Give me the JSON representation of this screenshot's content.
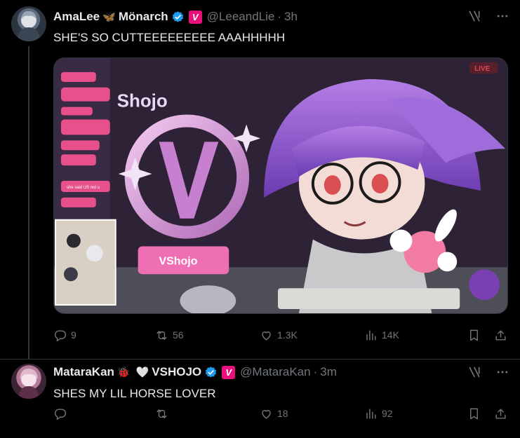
{
  "posts": [
    {
      "display_name": "AmaLee",
      "name_emoji": "🦋",
      "name_suffix": "Mönarch",
      "badge_letter": "V",
      "handle": "@LeeandLie",
      "separator": "·",
      "time": "3h",
      "text": "SHE'S SO CUTTEEEEEEEEE AAAHHHHH",
      "media": {
        "live_label": "LIVE",
        "brand_text": "Shojo",
        "trophy_text": "VShojo",
        "chat_message": "she said US not u"
      },
      "stats": {
        "replies": "9",
        "reposts": "56",
        "likes": "1.3K",
        "views": "14K"
      }
    },
    {
      "display_name": "MataraKan",
      "name_emoji": "🐞",
      "name_heart": "🤍",
      "name_suffix": "VSHOJO",
      "badge_letter": "V",
      "handle": "@MataraKan",
      "separator": "·",
      "time": "3m",
      "text": "SHES MY LIL HORSE LOVER",
      "stats": {
        "replies": "",
        "reposts": "",
        "likes": "18",
        "views": "92"
      }
    }
  ],
  "colors": {
    "background": "#000000",
    "text_primary": "#e7e9ea",
    "text_secondary": "#71767b",
    "verified_blue": "#1d9bf0",
    "vshojo_pink": "#e8107a",
    "divider": "#2f3336"
  },
  "icons": [
    "more-icon",
    "grok-icon",
    "reply-icon",
    "repost-icon",
    "like-icon",
    "views-icon",
    "bookmark-icon",
    "share-icon",
    "verified-icon"
  ]
}
